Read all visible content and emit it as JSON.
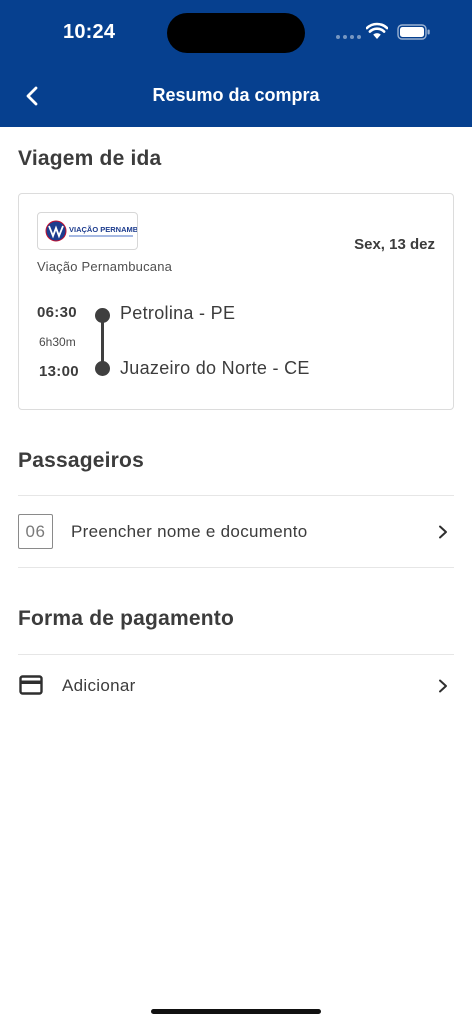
{
  "status_bar": {
    "time": "10:24"
  },
  "nav": {
    "title": "Resumo da compra"
  },
  "outbound": {
    "section_title": "Viagem de ida",
    "logo_text": "VIAÇÃO PERNAMBUCANA",
    "company": "Viação Pernambucana",
    "date": "Sex, 13 dez",
    "departure_time": "06:30",
    "duration": "6h30m",
    "arrival_time": "13:00",
    "origin": "Petrolina - PE",
    "destination": "Juazeiro do Norte - CE"
  },
  "passengers": {
    "section_title": "Passageiros",
    "seat": "06",
    "action_label": "Preencher nome e documento"
  },
  "payment": {
    "section_title": "Forma de pagamento",
    "action_label": "Adicionar"
  },
  "icons": {
    "back": "chevron-left-icon",
    "chevron": "chevron-right-icon",
    "card": "credit-card-icon"
  },
  "colors": {
    "header_bg": "#06408f",
    "text": "#3c3c3c"
  }
}
